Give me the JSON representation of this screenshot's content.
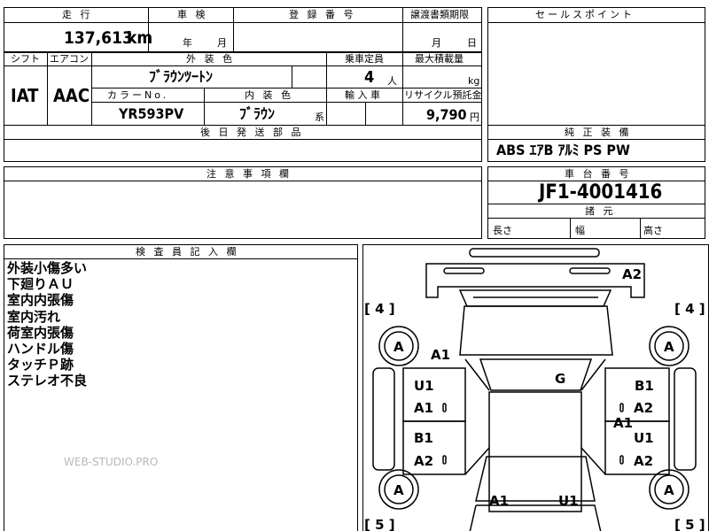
{
  "top": {
    "headers": {
      "mileage": "走 行",
      "inspection": "車 検",
      "registration": "登 録 番 号",
      "transfer_deadline": "譲渡書類期限",
      "selling_points": "セールスポイント"
    },
    "mileage_value": "137,613",
    "mileage_unit": "km",
    "inspection_year": "年",
    "inspection_month": "月",
    "transfer_month": "月",
    "transfer_day": "日"
  },
  "row2": {
    "headers": {
      "shift": "シフト",
      "aircon": "エアコン",
      "exterior_color": "外 装 色",
      "capacity": "乗車定員",
      "max_load": "最大積載量",
      "color_no": "カラーNo.",
      "interior_color": "内 装 色",
      "import": "輸 入 車",
      "recycle": "リサイクル預託金"
    },
    "shift_value": "IAT",
    "aircon_value": "AAC",
    "exterior_color_value": "ﾌﾞﾗｳﾝﾂｰﾄﾝ",
    "capacity_value": "4",
    "capacity_unit": "人",
    "load_unit": "kg",
    "color_no_value": "YR593PV",
    "interior_color_value": "ﾌﾞﾗｳﾝ",
    "interior_suffix": "系",
    "recycle_value": "9,790",
    "recycle_unit": "円"
  },
  "later_parts": {
    "header": "後 日 発 送 部 品"
  },
  "equipment": {
    "header": "純 正 装 備",
    "value": "ABS ｴｱB ｱﾙﾐ PS PW"
  },
  "caution": {
    "header": "注 意 事 項 欄"
  },
  "chassis": {
    "header": "車 台 番 号",
    "value": "JF1-4001416"
  },
  "dimensions": {
    "header": "諸 元",
    "length": "長さ",
    "width": "幅",
    "height": "高さ"
  },
  "inspector": {
    "header": "検 査 員 記 入 欄",
    "notes": [
      "外装小傷多い",
      "下廻りＡＵ",
      "室内内張傷",
      "室内汚れ",
      "荷室内張傷",
      "ハンドル傷",
      "タッチＰ跡",
      "ステレオ不良"
    ]
  },
  "watermark": "WEB-STUDIO.PRO",
  "diagram": {
    "tire_fl_bracket": "[ 4 ]",
    "tire_fr_bracket": "[ 4 ]",
    "tire_rl_bracket": "[ 5 ]",
    "tire_rr_bracket": "[ 5 ]",
    "marks": {
      "front_bumper": "A2",
      "tire_fl": "A",
      "tire_fr": "A",
      "tire_rl": "A",
      "tire_rr": "A",
      "hood_left": "A1",
      "windshield": "G",
      "left_front_door_u": "U1",
      "left_front_door_a": "A1",
      "left_rear_door_b": "B1",
      "left_rear_door_a": "A2",
      "right_front_door_b": "B1",
      "right_front_door_a": "A2",
      "right_pillar": "A1",
      "right_rear_door_u": "U1",
      "right_rear_door_a": "A2",
      "rear_left": "A1",
      "rear_right": "U1"
    }
  }
}
